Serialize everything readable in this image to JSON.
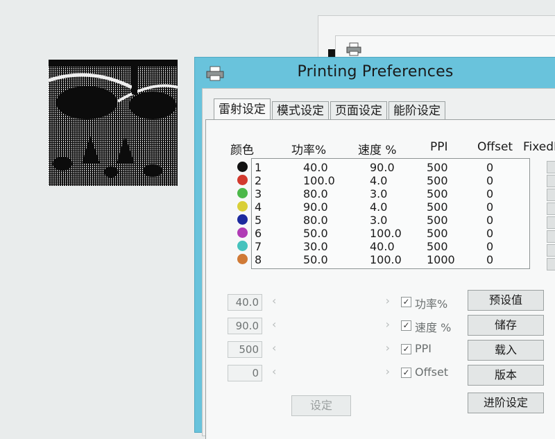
{
  "dialog": {
    "title": "Printing Preferences",
    "tabs": [
      {
        "label": "雷射设定",
        "active": true
      },
      {
        "label": "模式设定",
        "active": false
      },
      {
        "label": "页面设定",
        "active": false
      },
      {
        "label": "能阶设定",
        "active": false
      }
    ]
  },
  "table": {
    "headers": {
      "color": "颜色",
      "power": "功率%",
      "speed": "速度 %",
      "ppi": "PPI",
      "offset": "Offset",
      "fixed": "FixedF"
    },
    "rows": [
      {
        "idx": "1",
        "color": "#111111",
        "power": "40.0",
        "speed": "90.0",
        "ppi": "500",
        "offset": "0"
      },
      {
        "idx": "2",
        "color": "#d23a2e",
        "power": "100.0",
        "speed": "4.0",
        "ppi": "500",
        "offset": "0"
      },
      {
        "idx": "3",
        "color": "#4cb84a",
        "power": "80.0",
        "speed": "3.0",
        "ppi": "500",
        "offset": "0"
      },
      {
        "idx": "4",
        "color": "#d9cf38",
        "power": "90.0",
        "speed": "4.0",
        "ppi": "500",
        "offset": "0"
      },
      {
        "idx": "5",
        "color": "#1c2a9e",
        "power": "80.0",
        "speed": "3.0",
        "ppi": "500",
        "offset": "0"
      },
      {
        "idx": "6",
        "color": "#b03bb5",
        "power": "50.0",
        "speed": "100.0",
        "ppi": "500",
        "offset": "0"
      },
      {
        "idx": "7",
        "color": "#45c2bd",
        "power": "30.0",
        "speed": "40.0",
        "ppi": "500",
        "offset": "0"
      },
      {
        "idx": "8",
        "color": "#d07a36",
        "power": "50.0",
        "speed": "100.0",
        "ppi": "1000",
        "offset": "0"
      }
    ]
  },
  "controls": [
    {
      "value": "40.0",
      "label": "功率%",
      "checked": true
    },
    {
      "value": "90.0",
      "label": "速度 %",
      "checked": true
    },
    {
      "value": "500",
      "label": "PPI",
      "checked": true
    },
    {
      "value": "0",
      "label": "Offset",
      "checked": true
    }
  ],
  "slider_arrows": {
    "left": "‹",
    "right": "›"
  },
  "check_mark": "✓",
  "buttons": {
    "preset": "预设值",
    "save": "储存",
    "load": "载入",
    "version": "版本",
    "advanced": "进阶设定",
    "set": "设定"
  },
  "icons": {
    "printer": "printer-icon"
  }
}
